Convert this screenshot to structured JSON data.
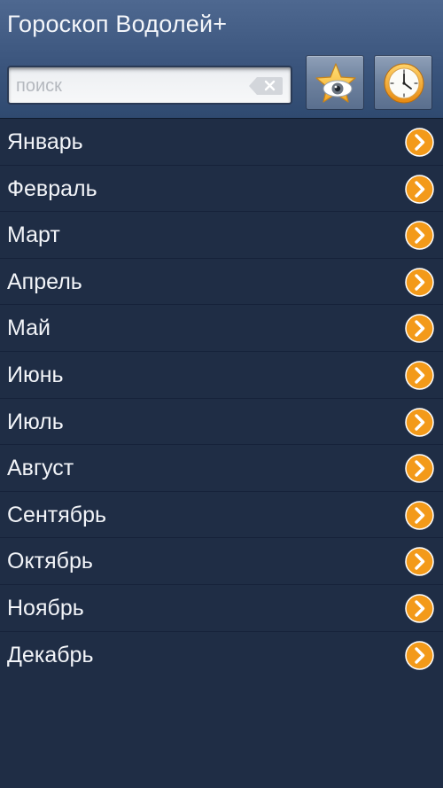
{
  "app": {
    "title": "Гороскоп Водолей+"
  },
  "search": {
    "placeholder": "поиск",
    "value": ""
  },
  "toolbar": {
    "buttons": [
      {
        "icon": "star-eye-icon"
      },
      {
        "icon": "clock-icon"
      }
    ]
  },
  "months": [
    {
      "label": "Январь",
      "icon": "chevron-right-icon"
    },
    {
      "label": "Февраль",
      "icon": "chevron-right-icon"
    },
    {
      "label": "Март",
      "icon": "chevron-right-icon"
    },
    {
      "label": "Апрель",
      "icon": "chevron-right-icon"
    },
    {
      "label": "Май",
      "icon": "chevron-right-icon"
    },
    {
      "label": "Июнь",
      "icon": "chevron-right-icon"
    },
    {
      "label": "Июль",
      "icon": "chevron-right-icon"
    },
    {
      "label": "Август",
      "icon": "chevron-right-icon"
    },
    {
      "label": "Сентябрь",
      "icon": "chevron-right-icon"
    },
    {
      "label": "Октябрь",
      "icon": "chevron-right-icon"
    },
    {
      "label": "Ноябрь",
      "icon": "chevron-right-icon"
    },
    {
      "label": "Декабрь",
      "icon": "chevron-right-icon"
    }
  ],
  "colors": {
    "background": "#1f2d45",
    "header": "#3b557d",
    "accent": "#f39a1a"
  }
}
